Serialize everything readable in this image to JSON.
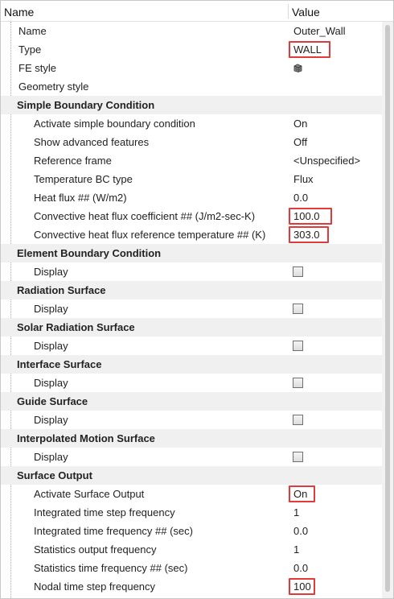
{
  "header": {
    "name": "Name",
    "value": "Value"
  },
  "general": {
    "name_label": "Name",
    "name_value": "Outer_Wall",
    "type_label": "Type",
    "type_value": "WALL",
    "fe_style_label": "FE style",
    "fe_style_icon": "mesh-cube-icon",
    "geometry_style_label": "Geometry style"
  },
  "simple_bc": {
    "title": "Simple Boundary Condition",
    "activate_label": "Activate simple boundary condition",
    "activate_value": "On",
    "advanced_label": "Show advanced features",
    "advanced_value": "Off",
    "frame_label": "Reference frame",
    "frame_value": "<Unspecified>",
    "temp_bc_label": "Temperature BC type",
    "temp_bc_value": "Flux",
    "heat_flux_label": "Heat flux ## (W/m2)",
    "heat_flux_value": "0.0",
    "conv_coeff_label": "Convective heat flux coefficient ## (J/m2-sec-K)",
    "conv_coeff_value": "100.0",
    "conv_temp_label": "Convective heat flux reference temperature ## (K)",
    "conv_temp_value": "303.0"
  },
  "element_bc": {
    "title": "Element Boundary Condition",
    "display_label": "Display",
    "display_checked": false
  },
  "radiation": {
    "title": "Radiation Surface",
    "display_label": "Display",
    "display_checked": false
  },
  "solar": {
    "title": "Solar Radiation Surface",
    "display_label": "Display",
    "display_checked": false
  },
  "interface": {
    "title": "Interface Surface",
    "display_label": "Display",
    "display_checked": false
  },
  "guide": {
    "title": "Guide Surface",
    "display_label": "Display",
    "display_checked": false
  },
  "interp_motion": {
    "title": "Interpolated Motion Surface",
    "display_label": "Display",
    "display_checked": false
  },
  "surface_output": {
    "title": "Surface Output",
    "activate_label": "Activate Surface Output",
    "activate_value": "On",
    "int_step_label": "Integrated time step frequency",
    "int_step_value": "1",
    "int_time_label": "Integrated time frequency ## (sec)",
    "int_time_value": "0.0",
    "stat_freq_label": "Statistics output frequency",
    "stat_freq_value": "1",
    "stat_time_label": "Statistics time frequency ## (sec)",
    "stat_time_value": "0.0",
    "nodal_label": "Nodal time step frequency",
    "nodal_value": "100"
  },
  "colors": {
    "highlight": "#e03a3a",
    "section_bg": "#f0f0f0"
  }
}
